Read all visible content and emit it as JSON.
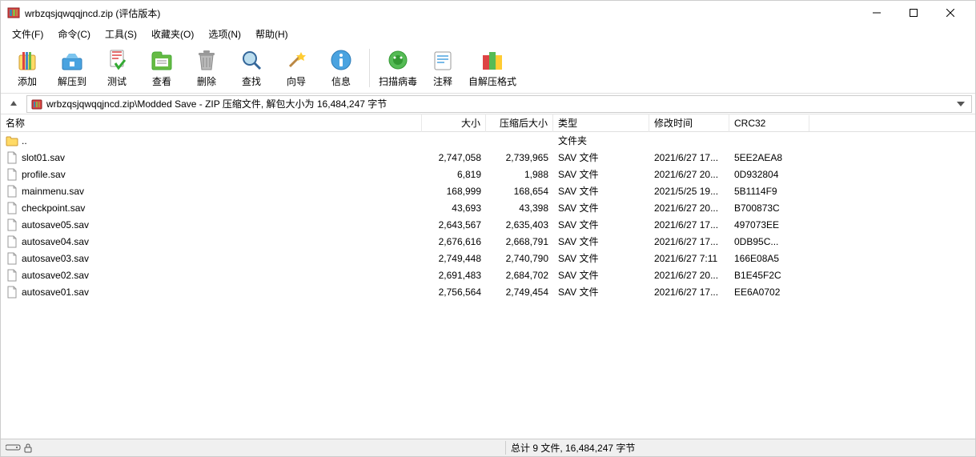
{
  "window": {
    "title": "wrbzqsjqwqqjncd.zip (评估版本)"
  },
  "menubar": {
    "items": [
      "文件(F)",
      "命令(C)",
      "工具(S)",
      "收藏夹(O)",
      "选项(N)",
      "帮助(H)"
    ]
  },
  "toolbar": {
    "add": "添加",
    "extract": "解压到",
    "test": "测试",
    "view": "查看",
    "delete": "删除",
    "find": "查找",
    "wizard": "向导",
    "info": "信息",
    "virus": "扫描病毒",
    "comment": "注释",
    "sfx": "自解压格式"
  },
  "pathbar": {
    "value": "wrbzqsjqwqqjncd.zip\\Modded Save - ZIP 压缩文件, 解包大小为 16,484,247 字节"
  },
  "columns": {
    "name": "名称",
    "size": "大小",
    "packed": "压缩后大小",
    "type": "类型",
    "modified": "修改时间",
    "crc": "CRC32"
  },
  "rows": [
    {
      "icon": "folder",
      "name": "..",
      "size": "",
      "packed": "",
      "type": "文件夹",
      "mod": "",
      "crc": ""
    },
    {
      "icon": "file",
      "name": "slot01.sav",
      "size": "2,747,058",
      "packed": "2,739,965",
      "type": "SAV 文件",
      "mod": "2021/6/27 17...",
      "crc": "5EE2AEA8"
    },
    {
      "icon": "file",
      "name": "profile.sav",
      "size": "6,819",
      "packed": "1,988",
      "type": "SAV 文件",
      "mod": "2021/6/27 20...",
      "crc": "0D932804"
    },
    {
      "icon": "file",
      "name": "mainmenu.sav",
      "size": "168,999",
      "packed": "168,654",
      "type": "SAV 文件",
      "mod": "2021/5/25 19...",
      "crc": "5B1114F9"
    },
    {
      "icon": "file",
      "name": "checkpoint.sav",
      "size": "43,693",
      "packed": "43,398",
      "type": "SAV 文件",
      "mod": "2021/6/27 20...",
      "crc": "B700873C"
    },
    {
      "icon": "file",
      "name": "autosave05.sav",
      "size": "2,643,567",
      "packed": "2,635,403",
      "type": "SAV 文件",
      "mod": "2021/6/27 17...",
      "crc": "497073EE"
    },
    {
      "icon": "file",
      "name": "autosave04.sav",
      "size": "2,676,616",
      "packed": "2,668,791",
      "type": "SAV 文件",
      "mod": "2021/6/27 17...",
      "crc": "0DB95C..."
    },
    {
      "icon": "file",
      "name": "autosave03.sav",
      "size": "2,749,448",
      "packed": "2,740,790",
      "type": "SAV 文件",
      "mod": "2021/6/27 7:11",
      "crc": "166E08A5"
    },
    {
      "icon": "file",
      "name": "autosave02.sav",
      "size": "2,691,483",
      "packed": "2,684,702",
      "type": "SAV 文件",
      "mod": "2021/6/27 20...",
      "crc": "B1E45F2C"
    },
    {
      "icon": "file",
      "name": "autosave01.sav",
      "size": "2,756,564",
      "packed": "2,749,454",
      "type": "SAV 文件",
      "mod": "2021/6/27 17...",
      "crc": "EE6A0702"
    }
  ],
  "status": {
    "total": "总计 9 文件, 16,484,247 字节"
  }
}
